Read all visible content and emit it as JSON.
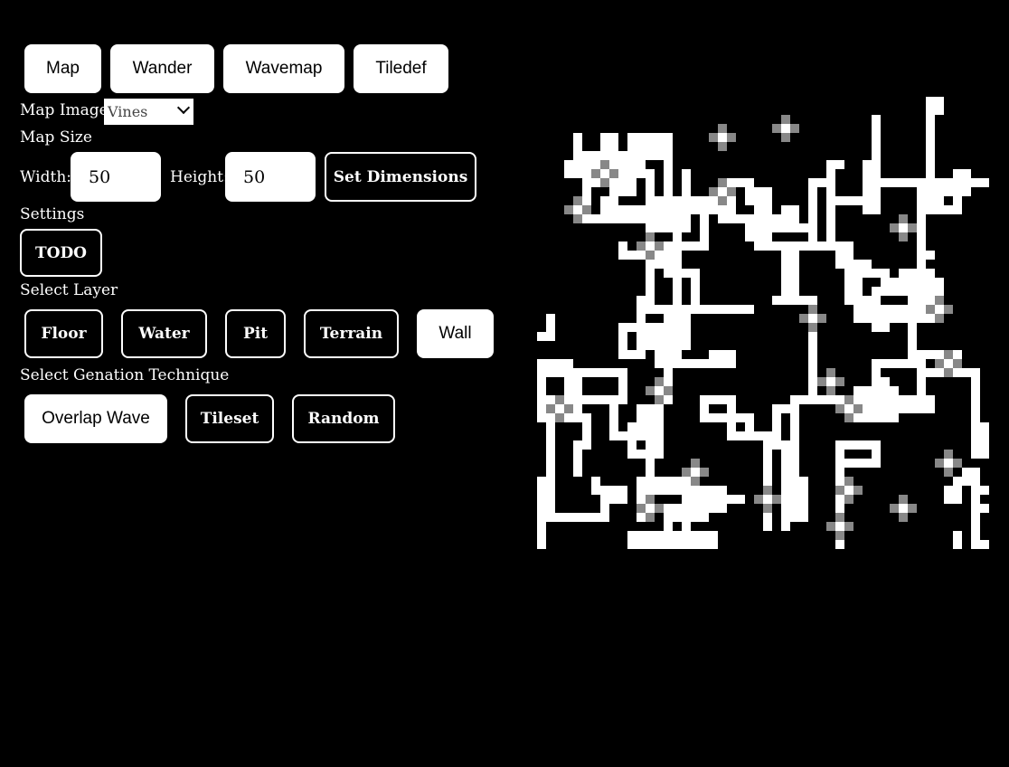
{
  "nav": {
    "map": "Map",
    "wander": "Wander",
    "wavemap": "Wavemap",
    "tiledef": "Tiledef"
  },
  "map_image": {
    "label": "Map Image",
    "selected": "Vines"
  },
  "map_size": {
    "label": "Map Size",
    "width_label": "Width:",
    "width_value": "50",
    "height_label": "Height:",
    "height_value": "50",
    "set_button": "Set Dimensions"
  },
  "settings": {
    "label": "Settings",
    "todo_button": "TODO"
  },
  "layers": {
    "label": "Select Layer",
    "floor": "Floor",
    "water": "Water",
    "pit": "Pit",
    "terrain": "Terrain",
    "wall": "Wall"
  },
  "generation": {
    "label": "Select Genation Technique",
    "overlap_wave": "Overlap Wave",
    "tileset": "Tileset",
    "random": "Random"
  },
  "canvas": {
    "grid_cols": 50,
    "grid_rows": 50,
    "wall_color": "#ffffff",
    "background_color": "#000000",
    "highlight_color": "#888888"
  }
}
